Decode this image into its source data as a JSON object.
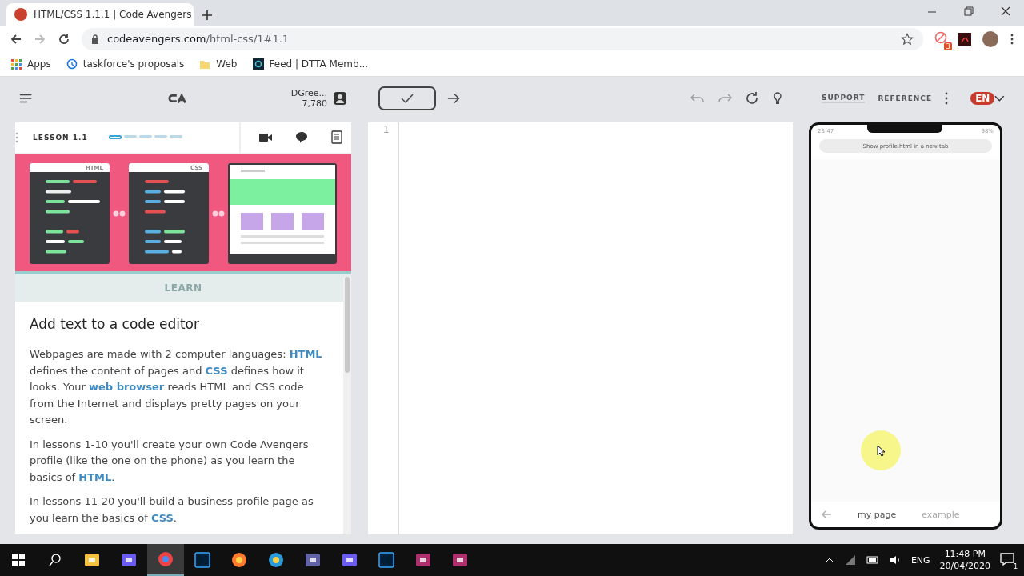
{
  "browser": {
    "tab_title": "HTML/CSS 1.1.1 | Code Avengers",
    "url_host": "codeavengers.com",
    "url_path": "/html-css/1#1.1",
    "bookmarks": [
      {
        "label": "Apps",
        "kind": "apps"
      },
      {
        "label": "taskforce's proposals",
        "kind": "history"
      },
      {
        "label": "Web",
        "kind": "folder"
      },
      {
        "label": "Feed | DTTA Memb...",
        "kind": "site"
      }
    ],
    "extension_badge": "3"
  },
  "header": {
    "user_name": "DGree...",
    "points": "7,780",
    "links": [
      "SUPPORT",
      "REFERENCE"
    ],
    "language": "EN"
  },
  "lesson": {
    "title": "LESSON 1.1",
    "steps": [
      {
        "selected": true
      },
      {
        "selected": false
      },
      {
        "selected": false
      },
      {
        "selected": false
      },
      {
        "selected": false
      }
    ],
    "windows": [
      {
        "label": "HTML",
        "kind": "code"
      },
      {
        "label": "CSS",
        "kind": "code"
      },
      {
        "kind": "browser"
      }
    ],
    "section": "LEARN",
    "heading": "Add text to a code editor",
    "paragraphs": [
      "Webpages are made with 2 computer languages: **HTML** defines the content of pages and **CSS** defines how it looks. Your **web browser** reads HTML and CSS code from the Internet and displays pretty pages on your screen.",
      "In lessons 1-10 you'll create your own Code Avengers profile (like the one on the phone) as you learn the basics of **HTML**.",
      "In lessons 11-20 you'll build a business profile page as you learn the basics of **CSS**."
    ]
  },
  "editor": {
    "line_numbers": [
      "1"
    ]
  },
  "phone": {
    "time": "23:47",
    "battery": "98%",
    "banner": "Show profile.html in a new tab",
    "tabs": [
      {
        "label": "my page",
        "selected": true
      },
      {
        "label": "example",
        "selected": false
      }
    ]
  },
  "taskbar": {
    "apps": [
      {
        "kind": "explorer",
        "selected": false
      },
      {
        "kind": "app",
        "selected": false
      },
      {
        "kind": "chrome",
        "selected": true
      },
      {
        "kind": "ps",
        "selected": false
      },
      {
        "kind": "firefox",
        "selected": false
      },
      {
        "kind": "edge",
        "selected": false
      },
      {
        "kind": "teams",
        "selected": false
      },
      {
        "kind": "app",
        "selected": false
      },
      {
        "kind": "ps",
        "selected": false
      },
      {
        "kind": "meet",
        "selected": false
      },
      {
        "kind": "meet",
        "selected": false
      }
    ],
    "language": "ENG",
    "time": "11:48 PM",
    "date": "20/04/2020",
    "notifications": "1"
  }
}
